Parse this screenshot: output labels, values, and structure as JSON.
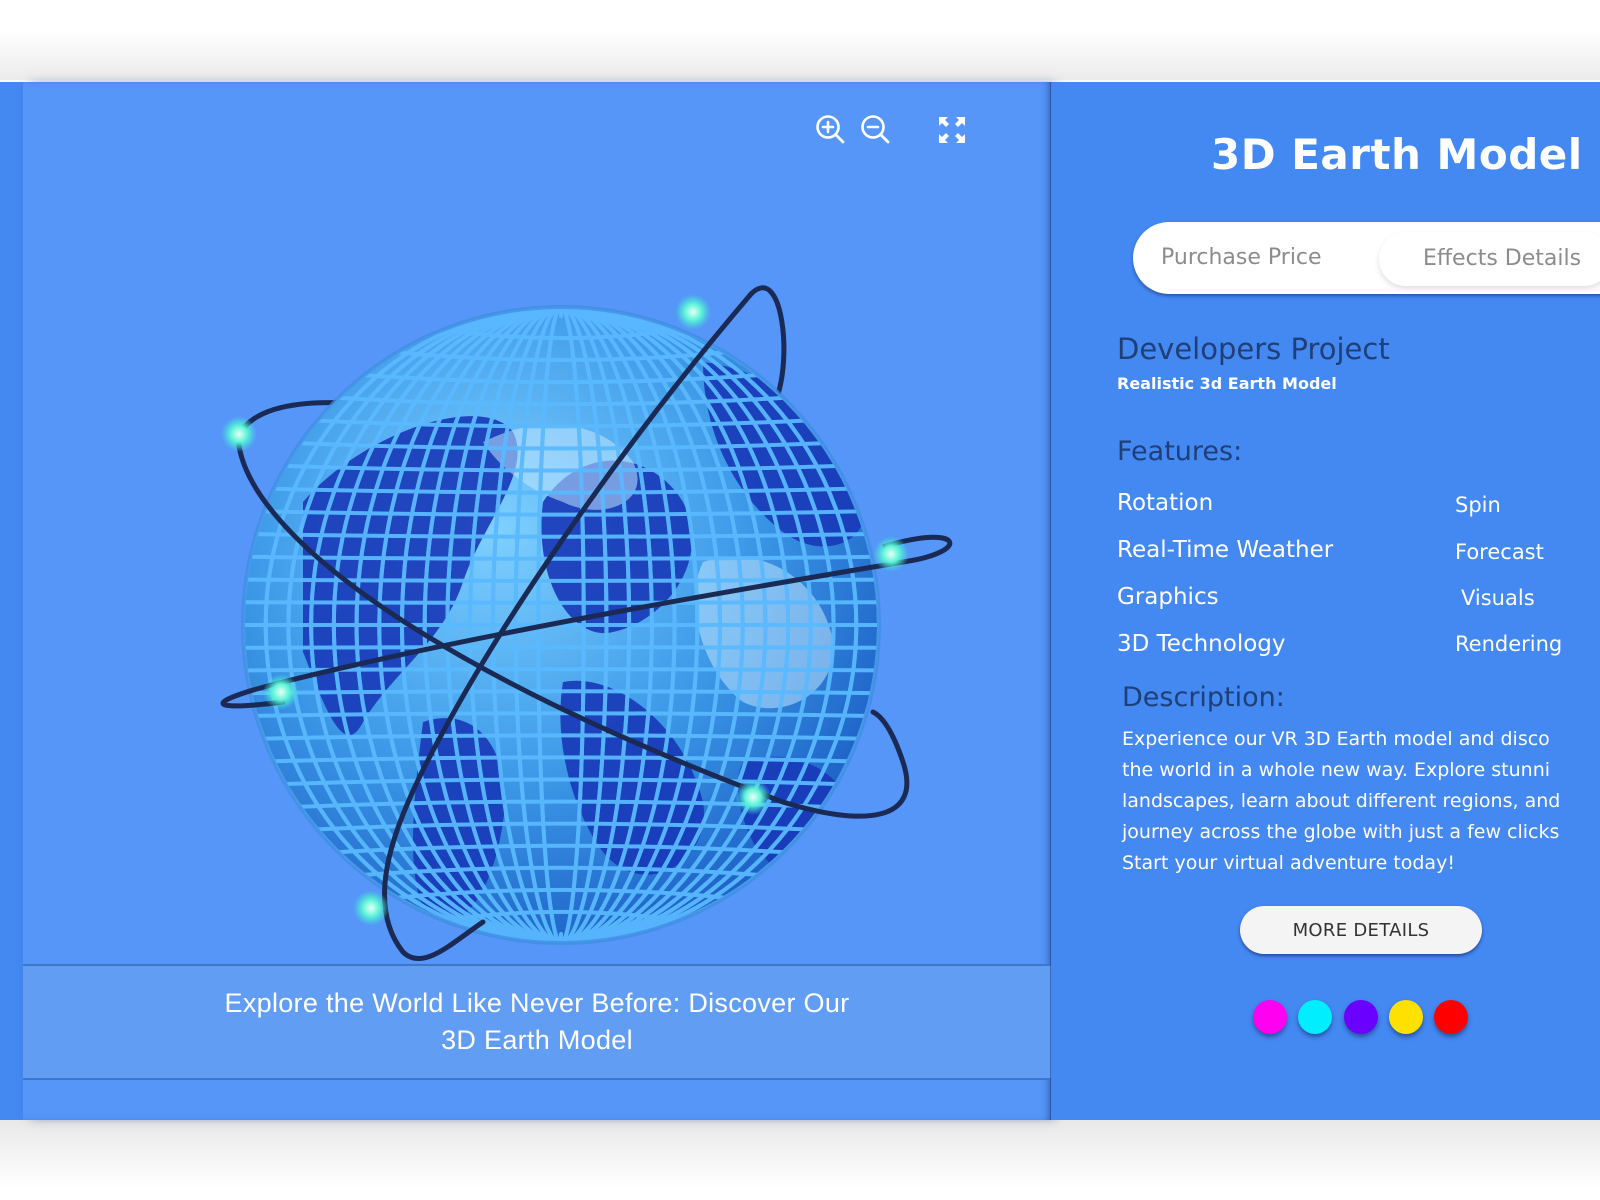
{
  "viewer": {
    "toolbar": {
      "zoom_in_icon": "zoom-in-icon",
      "zoom_out_icon": "zoom-out-icon",
      "fullscreen_icon": "fullscreen-icon"
    },
    "image_alt": "3D wireframe globe with orbiting rings",
    "caption_line1": "Explore the World Like Never Before: Discover Our",
    "caption_line2": "3D Earth Model"
  },
  "panel": {
    "title": "3D Earth Model",
    "tabs": [
      {
        "label": "Purchase Price"
      },
      {
        "label": "Effects Details"
      }
    ],
    "project_heading": "Developers Project",
    "project_subtitle": "Realistic 3d Earth Model",
    "features_heading": "Features:",
    "features": [
      {
        "name": "Rotation",
        "value": "Spin"
      },
      {
        "name": "Real-Time Weather",
        "value": "Forecast"
      },
      {
        "name": "Graphics",
        "value": "Visuals"
      },
      {
        "name": "3D Technology",
        "value": "Rendering"
      }
    ],
    "description_heading": "Description:",
    "description_lines": [
      "Experience our VR 3D Earth model and disco",
      "the world in a whole new way. Explore stunni",
      "landscapes, learn about different regions, and",
      "journey across the globe with just a few clicks",
      "Start your virtual adventure today!"
    ],
    "more_details_label": "MORE DETAILS",
    "color_options": [
      {
        "name": "magenta",
        "hex": "#ff00f0"
      },
      {
        "name": "cyan",
        "hex": "#00eeff"
      },
      {
        "name": "violet",
        "hex": "#6a00ff"
      },
      {
        "name": "yellow",
        "hex": "#ffe100"
      },
      {
        "name": "red",
        "hex": "#ff0000"
      }
    ]
  }
}
